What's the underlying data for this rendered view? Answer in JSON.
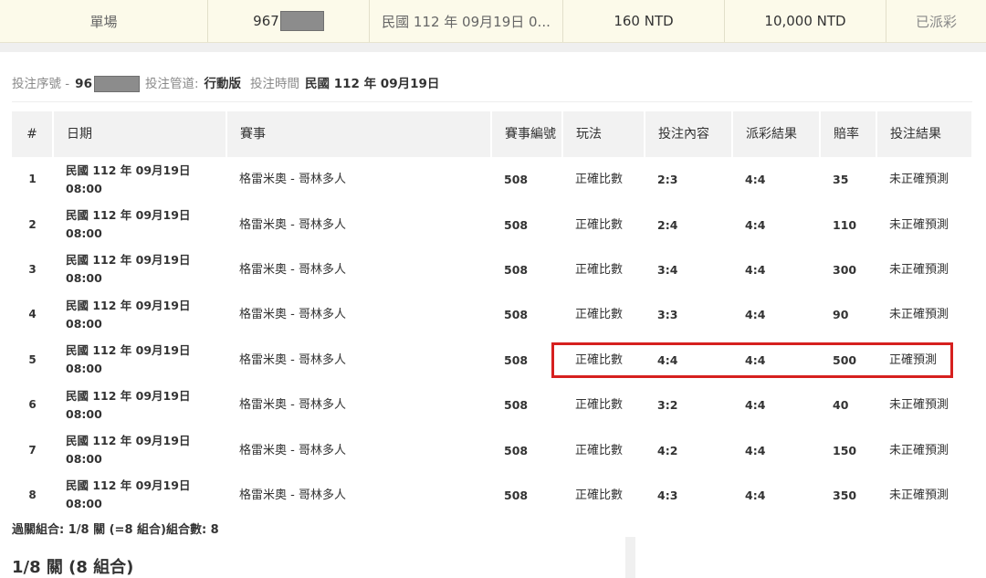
{
  "summary": {
    "play_type": "單場",
    "bet_no_prefix": "967",
    "bet_time": "民國 112 年 09月19日 0...",
    "stake": "160 NTD",
    "max_payout": "10,000 NTD",
    "status": "已派彩"
  },
  "bet_info": {
    "serial_label": "投注序號 -",
    "serial_prefix": "96",
    "channel_label": "投注管道:",
    "channel_value": "行動版",
    "time_label": "投注時間",
    "time_value": "民國 112 年 09月19日"
  },
  "table": {
    "headers": [
      "#",
      "日期",
      "賽事",
      "賽事編號",
      "玩法",
      "投注內容",
      "派彩結果",
      "賠率",
      "投注結果"
    ],
    "rows": [
      {
        "no": "1",
        "date": "民國 112 年 09月19日",
        "time": "08:00",
        "match": "格雷米奧 - 哥林多人",
        "match_no": "508",
        "play": "正確比數",
        "pick": "2:3",
        "result": "4:4",
        "odds": "35",
        "outcome": "未正確預測"
      },
      {
        "no": "2",
        "date": "民國 112 年 09月19日",
        "time": "08:00",
        "match": "格雷米奧 - 哥林多人",
        "match_no": "508",
        "play": "正確比數",
        "pick": "2:4",
        "result": "4:4",
        "odds": "110",
        "outcome": "未正確預測"
      },
      {
        "no": "3",
        "date": "民國 112 年 09月19日",
        "time": "08:00",
        "match": "格雷米奧 - 哥林多人",
        "match_no": "508",
        "play": "正確比數",
        "pick": "3:4",
        "result": "4:4",
        "odds": "300",
        "outcome": "未正確預測"
      },
      {
        "no": "4",
        "date": "民國 112 年 09月19日",
        "time": "08:00",
        "match": "格雷米奧 - 哥林多人",
        "match_no": "508",
        "play": "正確比數",
        "pick": "3:3",
        "result": "4:4",
        "odds": "90",
        "outcome": "未正確預測"
      },
      {
        "no": "5",
        "date": "民國 112 年 09月19日",
        "time": "08:00",
        "match": "格雷米奧 - 哥林多人",
        "match_no": "508",
        "play": "正確比數",
        "pick": "4:4",
        "result": "4:4",
        "odds": "500",
        "outcome": "正確預測"
      },
      {
        "no": "6",
        "date": "民國 112 年 09月19日",
        "time": "08:00",
        "match": "格雷米奧 - 哥林多人",
        "match_no": "508",
        "play": "正確比數",
        "pick": "3:2",
        "result": "4:4",
        "odds": "40",
        "outcome": "未正確預測"
      },
      {
        "no": "7",
        "date": "民國 112 年 09月19日",
        "time": "08:00",
        "match": "格雷米奧 - 哥林多人",
        "match_no": "508",
        "play": "正確比數",
        "pick": "4:2",
        "result": "4:4",
        "odds": "150",
        "outcome": "未正確預測"
      },
      {
        "no": "8",
        "date": "民國 112 年 09月19日",
        "time": "08:00",
        "match": "格雷米奧 - 哥林多人",
        "match_no": "508",
        "play": "正確比數",
        "pick": "4:3",
        "result": "4:4",
        "odds": "350",
        "outcome": "未正確預測"
      }
    ]
  },
  "parlay_summary": "過關組合: 1/8 關 (=8 組合)組合數: 8",
  "section_title": "1/8 關 (8 組合)",
  "colors": {
    "summary_bg": "#fcfaea",
    "header_bg": "#f2f2f2",
    "highlight": "#d6201f"
  }
}
